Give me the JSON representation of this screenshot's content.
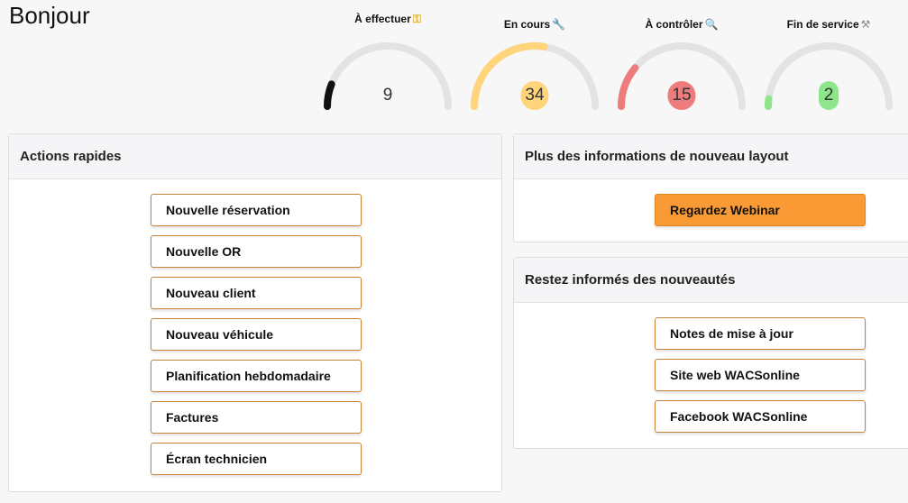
{
  "greeting": "Bonjour",
  "gauges": [
    {
      "label": "À effectuer",
      "icon": "key-icon",
      "value": "9",
      "fraction": 0.12,
      "color": "#111111",
      "badge": ""
    },
    {
      "label": "En cours",
      "icon": "wrench-icon",
      "value": "34",
      "fraction": 0.55,
      "color": "#ffd47a",
      "badge": "#ffd47a"
    },
    {
      "label": "À contrôler",
      "icon": "magnifier-icon",
      "value": "15",
      "fraction": 0.22,
      "color": "#ee7c7c",
      "badge": "#ee7c7c"
    },
    {
      "label": "Fin de service",
      "icon": "tools-icon",
      "value": "2",
      "fraction": 0.04,
      "color": "#8ee68a",
      "badge": "#8ee68a"
    }
  ],
  "quick_actions": {
    "title": "Actions rapides",
    "buttons": [
      "Nouvelle réservation",
      "Nouvelle OR",
      "Nouveau client",
      "Nouveau véhicule",
      "Planification hebdomadaire",
      "Factures",
      "Écran technicien"
    ]
  },
  "layout_info": {
    "title": "Plus des informations de nouveau layout",
    "button": "Regardez Webinar",
    "button_color": "#f99a34"
  },
  "news": {
    "title": "Restez informés des nouveautés",
    "buttons": [
      "Notes de mise à jour",
      "Site web WACSonline",
      "Facebook WACSonline"
    ]
  },
  "colors": {
    "accent_border": "#c8823a",
    "track": "#e3e3e3"
  }
}
